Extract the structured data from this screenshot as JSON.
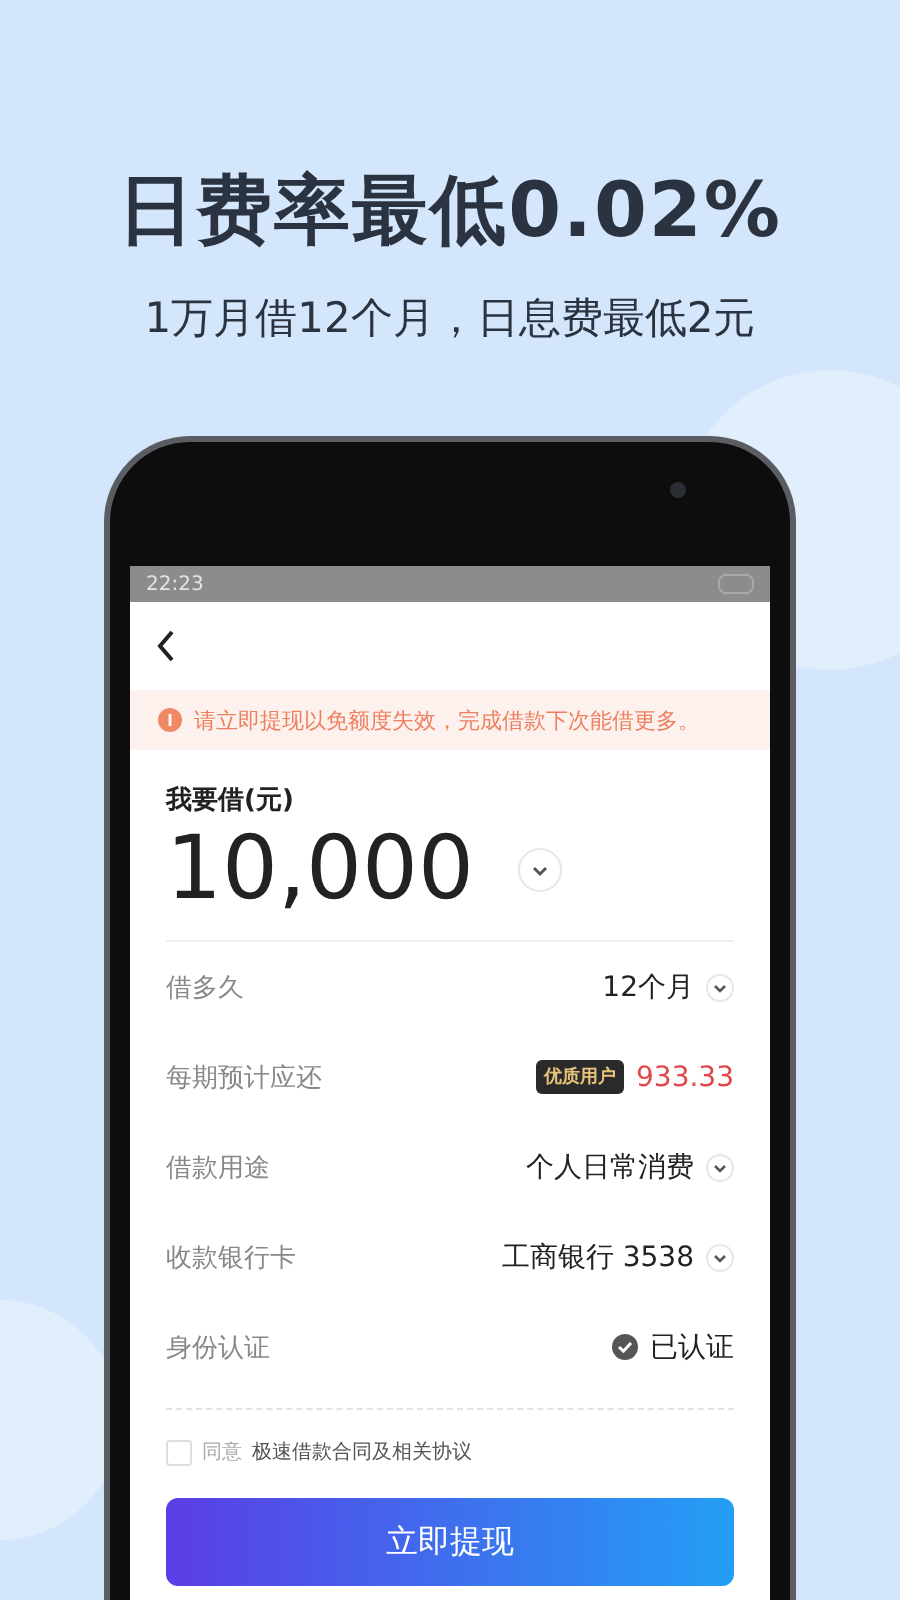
{
  "headline": "日费率最低0.02%",
  "subheadline": "1万月借12个月，日息费最低2元",
  "status_bar": {
    "time": "22:23"
  },
  "notice": "请立即提现以免额度失效，完成借款下次能借更多。",
  "amount": {
    "label": "我要借(元)",
    "value": "10,000"
  },
  "rows": [
    {
      "kind": "select",
      "label": "借多久",
      "value": "12个月"
    },
    {
      "kind": "price",
      "label": "每期预计应还",
      "badge": "优质用户",
      "value": "933.33"
    },
    {
      "kind": "select",
      "label": "借款用途",
      "value": "个人日常消费"
    },
    {
      "kind": "select",
      "label": "收款银行卡",
      "value": "工商银行 3538"
    },
    {
      "kind": "verified",
      "label": "身份认证",
      "value": "已认证"
    }
  ],
  "agreement": {
    "checked": false,
    "prefix": "同意",
    "link": "极速借款合同及相关协议"
  },
  "submit": "立即提现"
}
